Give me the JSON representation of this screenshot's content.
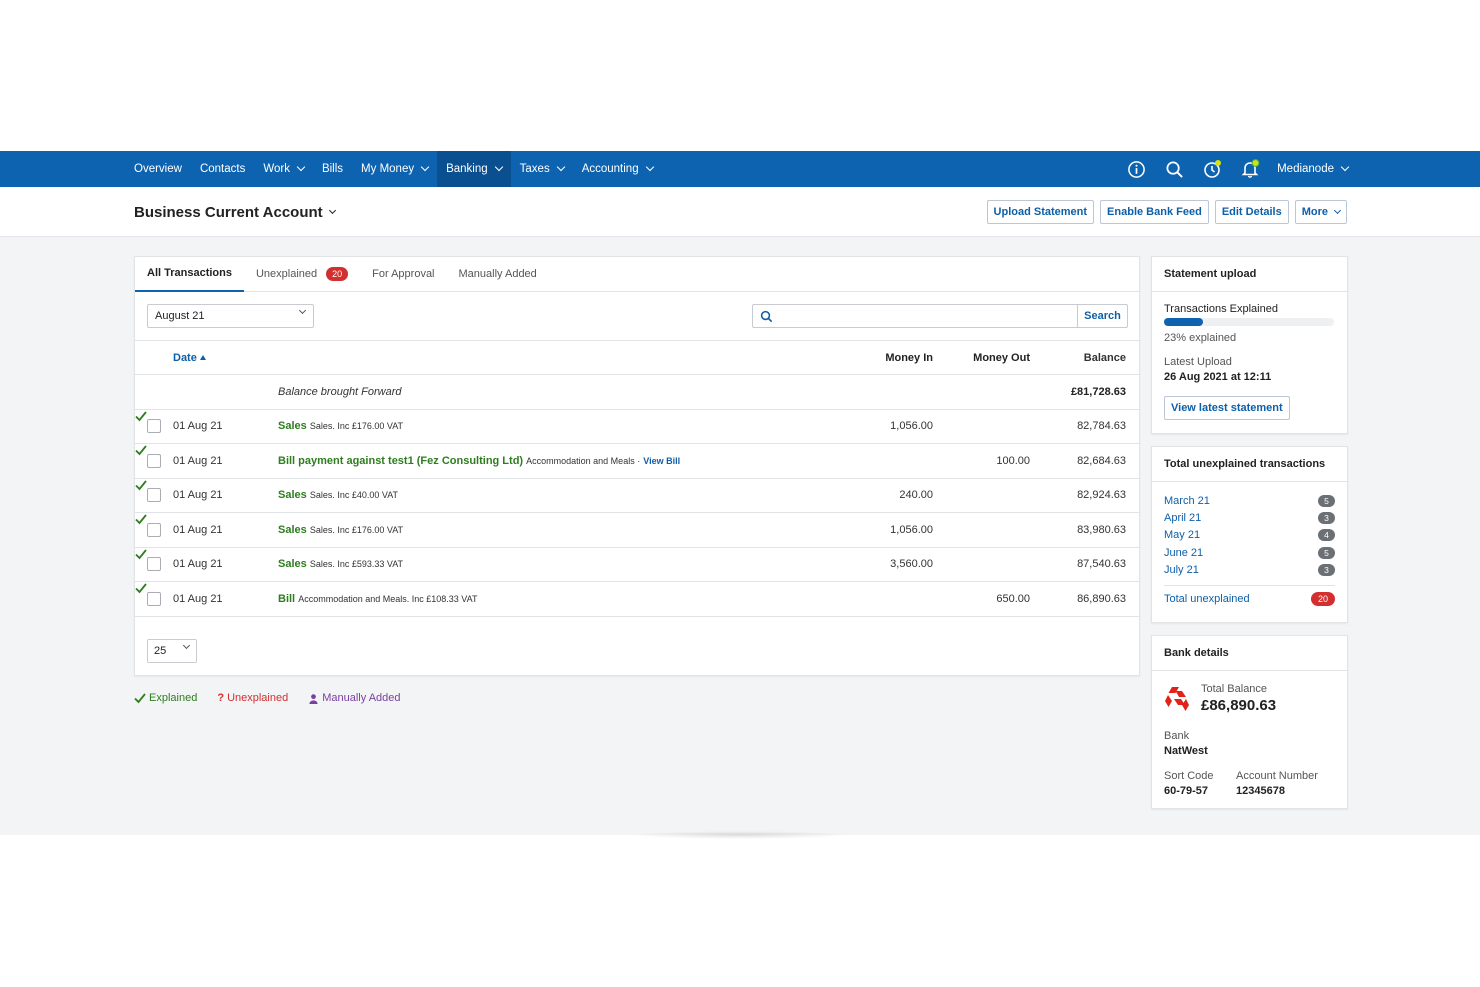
{
  "nav": {
    "items": [
      {
        "label": "Overview",
        "dropdown": false
      },
      {
        "label": "Contacts",
        "dropdown": false
      },
      {
        "label": "Work",
        "dropdown": true
      },
      {
        "label": "Bills",
        "dropdown": false
      },
      {
        "label": "My Money",
        "dropdown": true
      },
      {
        "label": "Banking",
        "dropdown": true,
        "active": true
      },
      {
        "label": "Taxes",
        "dropdown": true
      },
      {
        "label": "Accounting",
        "dropdown": true
      }
    ],
    "user": "Medianode",
    "icons": [
      "info-icon",
      "search-icon",
      "timer-icon",
      "bell-icon"
    ],
    "color": "#0d63b0"
  },
  "header": {
    "title": "Business Current Account",
    "buttons": {
      "upload": "Upload Statement",
      "feed": "Enable Bank Feed",
      "edit": "Edit Details",
      "more": "More"
    }
  },
  "tabs": {
    "all": "All Transactions",
    "unexplained": "Unexplained",
    "unexplained_count": "20",
    "approval": "For Approval",
    "manual": "Manually Added"
  },
  "filters": {
    "month": "August 21",
    "search_placeholder": "",
    "search_button": "Search"
  },
  "table": {
    "headers": {
      "date": "Date",
      "money_in": "Money In",
      "money_out": "Money Out",
      "balance": "Balance"
    },
    "bbf_label": "Balance brought Forward",
    "bbf_value": "£81,728.63",
    "rows": [
      {
        "date": "01 Aug 21",
        "kind": "Sales",
        "detail": "Sales. Inc £176.00 VAT",
        "link": "",
        "money_in": "1,056.00",
        "money_out": "",
        "balance": "82,784.63"
      },
      {
        "date": "01 Aug 21",
        "kind": "Bill payment against test1 (Fez Consulting Ltd)",
        "detail": "Accommodation and Meals ·",
        "link": "View Bill",
        "money_in": "",
        "money_out": "100.00",
        "balance": "82,684.63"
      },
      {
        "date": "01 Aug 21",
        "kind": "Sales",
        "detail": "Sales. Inc £40.00 VAT",
        "link": "",
        "money_in": "240.00",
        "money_out": "",
        "balance": "82,924.63"
      },
      {
        "date": "01 Aug 21",
        "kind": "Sales",
        "detail": "Sales. Inc £176.00 VAT",
        "link": "",
        "money_in": "1,056.00",
        "money_out": "",
        "balance": "83,980.63"
      },
      {
        "date": "01 Aug 21",
        "kind": "Sales",
        "detail": "Sales. Inc £593.33 VAT",
        "link": "",
        "money_in": "3,560.00",
        "money_out": "",
        "balance": "87,540.63"
      },
      {
        "date": "01 Aug 21",
        "kind": "Bill",
        "detail": "Accommodation and Meals. Inc £108.33 VAT",
        "link": "",
        "money_in": "",
        "money_out": "650.00",
        "balance": "86,890.63"
      }
    ],
    "per_page": "25"
  },
  "legend": {
    "explained": "Explained",
    "unexplained": "Unexplained",
    "manual": "Manually Added",
    "colors": {
      "explained": "#2e7d1f",
      "unexplained": "#d32f2f",
      "manual": "#7b3fa0"
    }
  },
  "statement": {
    "title": "Statement upload",
    "explained_label": "Transactions Explained",
    "explained_fraction": 0.23,
    "explained_text": "23% explained",
    "latest_label": "Latest Upload",
    "latest_value": "26 Aug 2021 at 12:11",
    "view_button": "View latest statement"
  },
  "unexplained_panel": {
    "title": "Total unexplained transactions",
    "months": [
      {
        "label": "March 21",
        "count": "5"
      },
      {
        "label": "April 21",
        "count": "3"
      },
      {
        "label": "May 21",
        "count": "4"
      },
      {
        "label": "June 21",
        "count": "5"
      },
      {
        "label": "July 21",
        "count": "3"
      }
    ],
    "total_label": "Total unexplained",
    "total_count": "20"
  },
  "bank": {
    "title": "Bank details",
    "balance_label": "Total Balance",
    "balance_value": "£86,890.63",
    "bank_label": "Bank",
    "bank_value": "NatWest",
    "sort_label": "Sort Code",
    "sort_value": "60-79-57",
    "acct_label": "Account Number",
    "acct_value": "12345678",
    "logo_color": "#e2231a"
  }
}
